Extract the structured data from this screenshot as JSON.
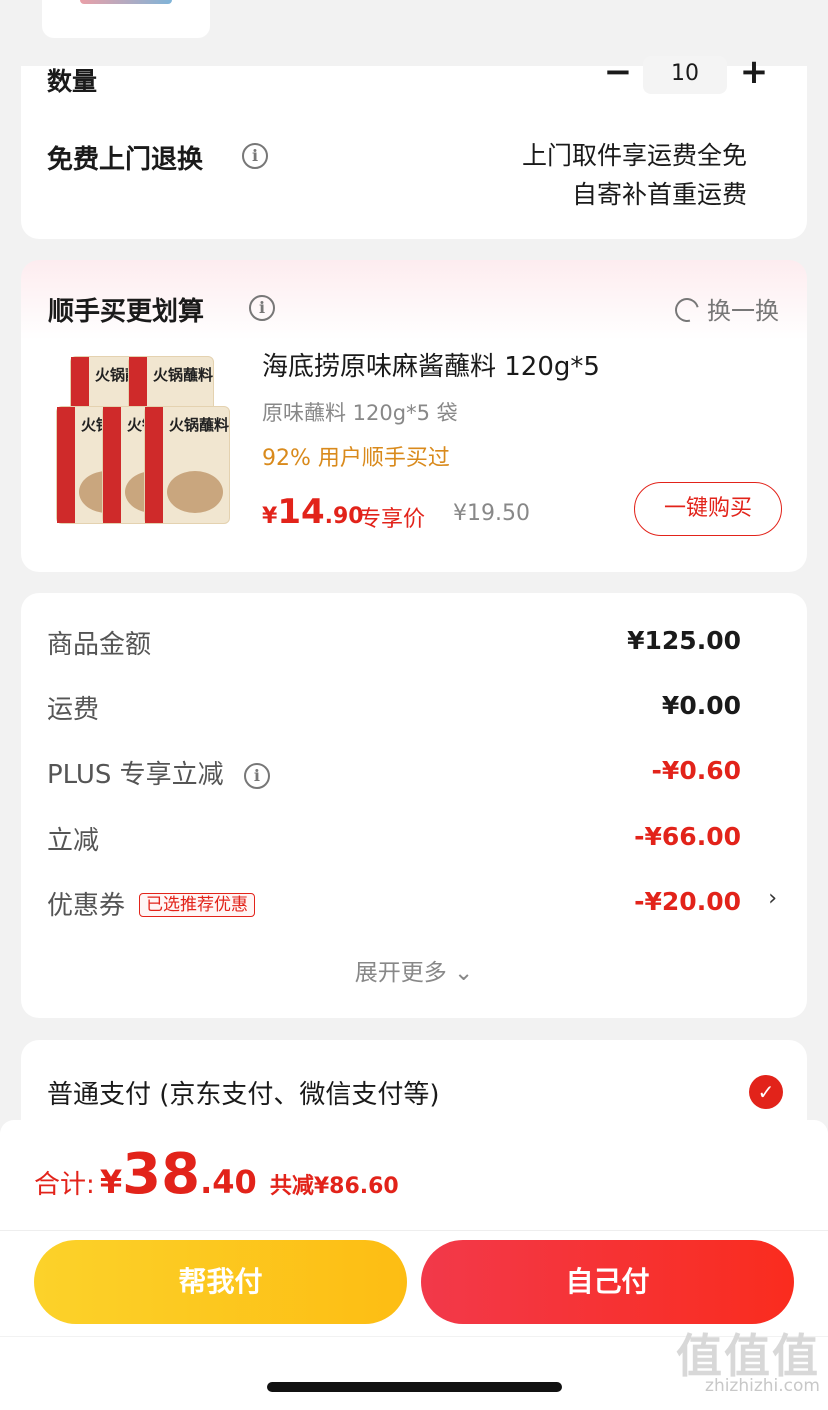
{
  "order": {
    "qty_label": "数量",
    "qty_minus": "−",
    "qty_value": "10",
    "qty_plus": "+",
    "return_label": "免费上门退换",
    "return_line1": "上门取件享运费全免",
    "return_line2": "自寄补首重运费"
  },
  "upsell": {
    "title": "顺手买更划算",
    "swap_label": "换一换",
    "product": {
      "name": "海底捞原味麻酱蘸料 120g*5",
      "spec": "原味蘸料 120g*5 袋",
      "bought_pct": "92% 用户顺手买过",
      "price_currency": "¥",
      "price_int": "14",
      "price_dec": ".90",
      "price_tag": "专享价",
      "original_price": "¥19.50",
      "buy_button": "一键购买",
      "pack_text": "火锅蘸料"
    }
  },
  "totals": {
    "goods_label": "商品金额",
    "goods_value": "¥125.00",
    "shipping_label": "运费",
    "shipping_value": "¥0.00",
    "plus_label": "PLUS 专享立减",
    "plus_value": "-¥0.60",
    "discount_label": "立减",
    "discount_value": "-¥66.00",
    "coupon_label": "优惠券",
    "coupon_badge": "已选推荐优惠",
    "coupon_value": "-¥20.00",
    "expand_label": "展开更多 ⌄"
  },
  "payment": {
    "method_label": "普通支付 (京东支付、微信支付等)"
  },
  "footer": {
    "total_label": "合计:",
    "total_currency": "¥",
    "total_int": "38",
    "total_dec": ".40",
    "total_saved": "共减¥86.60",
    "help_pay_button": "帮我付",
    "self_pay_button": "自己付",
    "watermark": "值值值",
    "watermark_url": "zhizhizhi.com"
  },
  "colors": {
    "accent_red": "#e2231a",
    "accent_yellow": "#fdbd13",
    "highlight_orange": "#d98a1c"
  }
}
